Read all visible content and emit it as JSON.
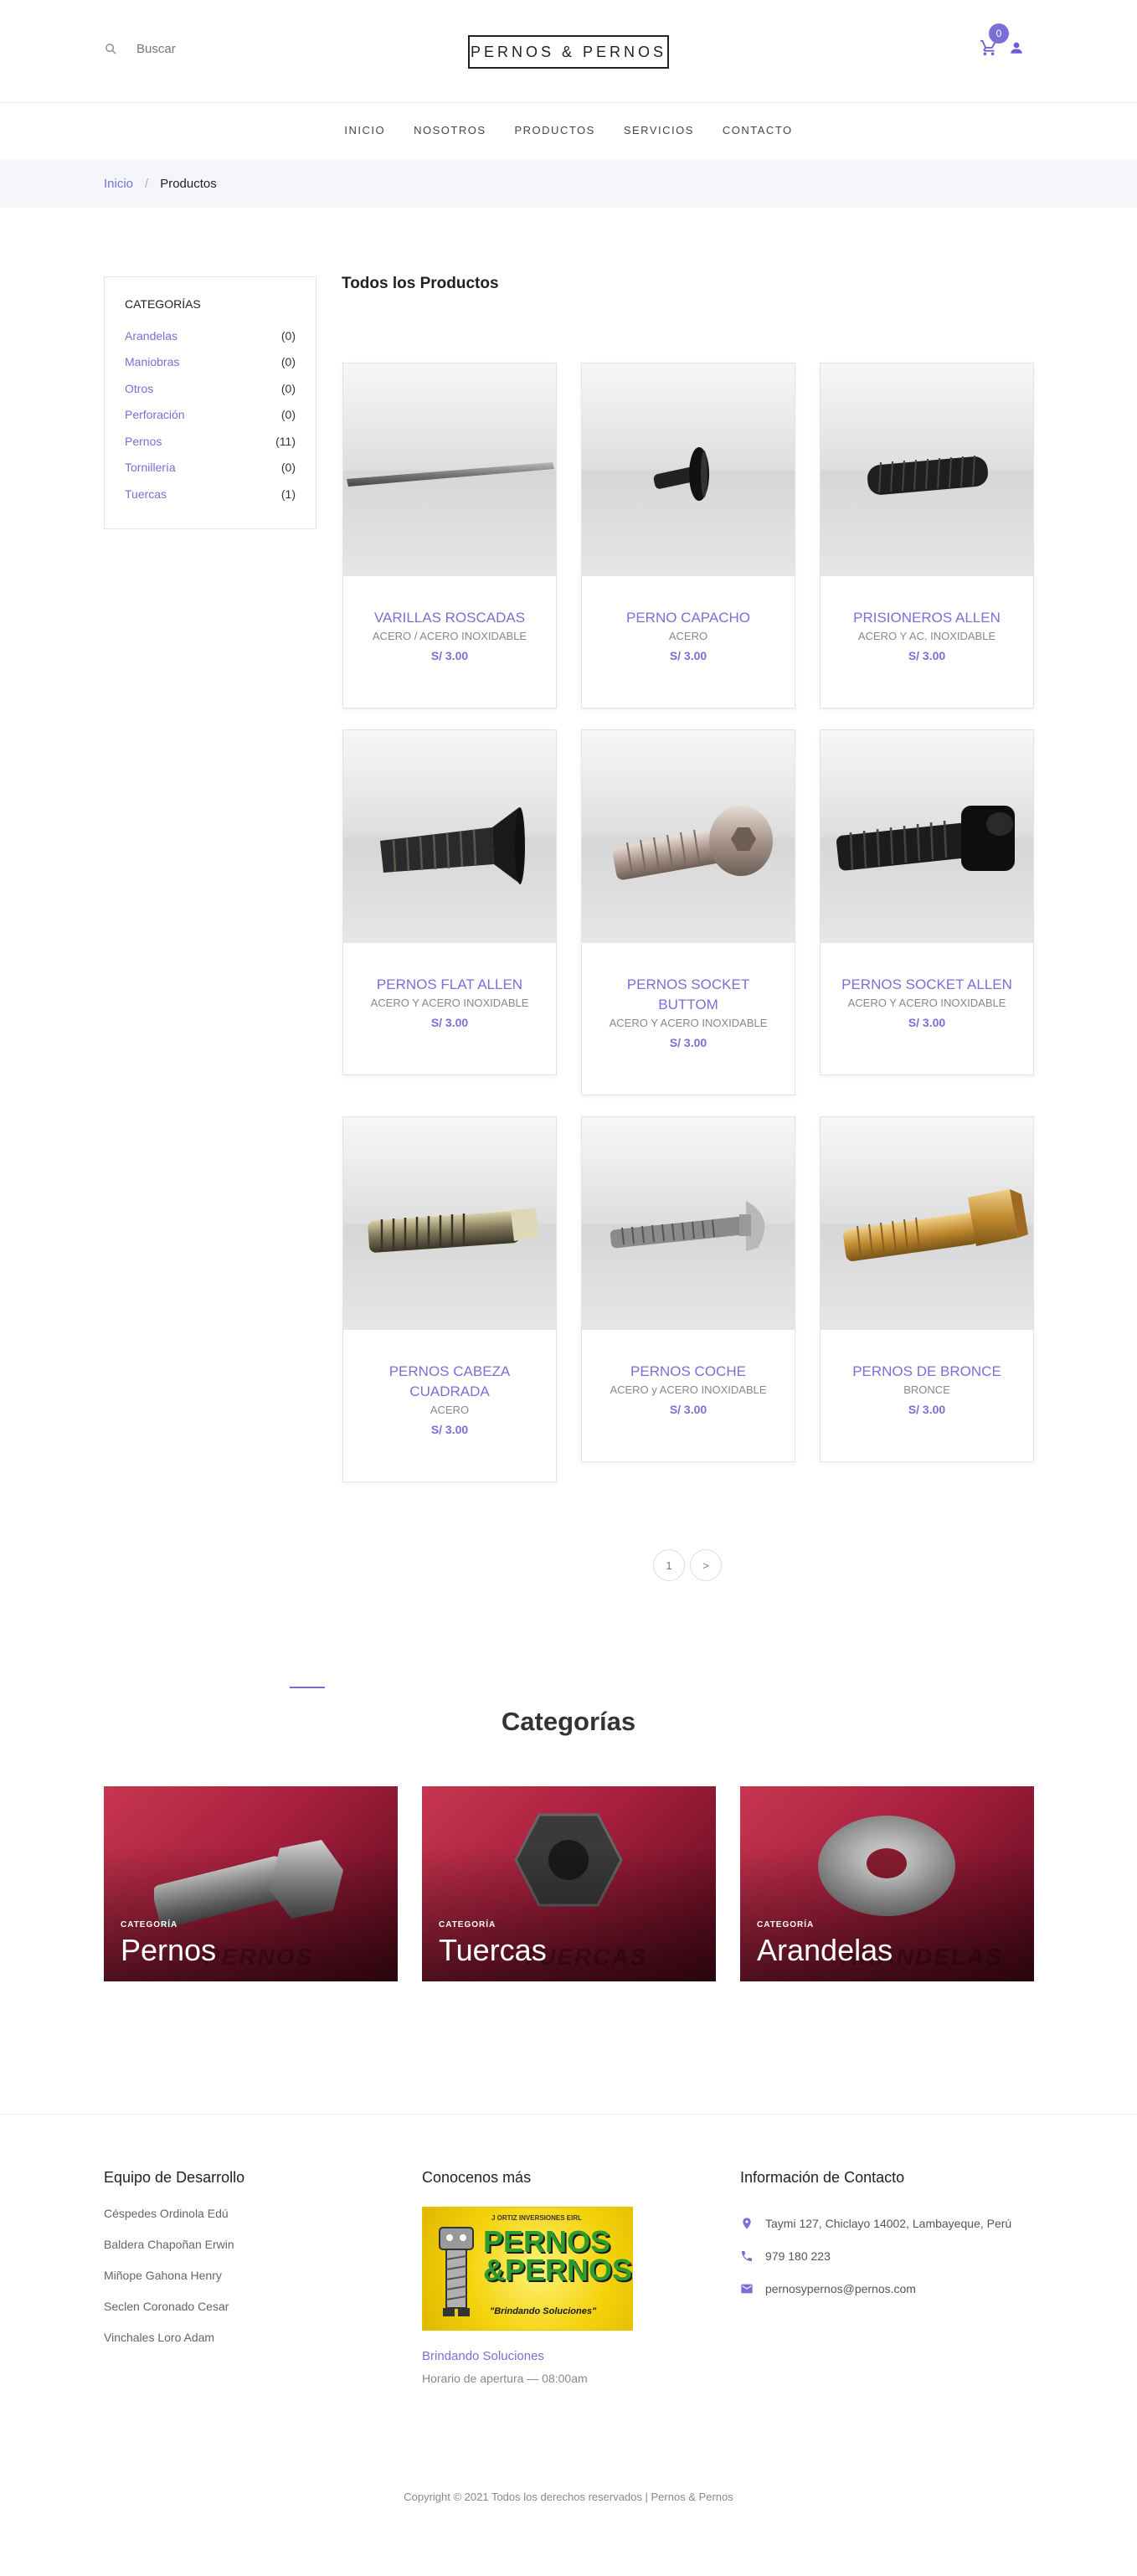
{
  "header": {
    "search_label": "Buscar",
    "logo": "PERNOS & PERNOS",
    "cart_count": "0"
  },
  "nav": [
    "INICIO",
    "NOSOTROS",
    "PRODUCTOS",
    "SERVICIOS",
    "CONTACTO"
  ],
  "breadcrumb": {
    "home": "Inicio",
    "separator": "/",
    "current": "Productos"
  },
  "sidebar": {
    "title": "CATEGORÍAS",
    "items": [
      {
        "name": "Arandelas",
        "count": "(0)"
      },
      {
        "name": "Maniobras",
        "count": "(0)"
      },
      {
        "name": "Otros",
        "count": "(0)"
      },
      {
        "name": "Perforación",
        "count": "(0)"
      },
      {
        "name": "Pernos",
        "count": "(11)"
      },
      {
        "name": "Tornillería",
        "count": "(0)"
      },
      {
        "name": "Tuercas",
        "count": "(1)"
      }
    ]
  },
  "products_title": "Todos los Productos",
  "products": [
    {
      "title": "VARILLAS ROSCADAS",
      "sub": "ACERO / ACERO INOXIDABLE",
      "price": "S/ 3.00",
      "icon": "threaded-rod"
    },
    {
      "title": "PERNO CAPACHO",
      "sub": "ACERO",
      "price": "S/ 3.00",
      "icon": "mushroom-bolt"
    },
    {
      "title": "PRISIONEROS ALLEN",
      "sub": "ACERO Y AC. INOXIDABLE",
      "price": "S/ 3.00",
      "icon": "set-screw"
    },
    {
      "title": "PERNOS FLAT ALLEN",
      "sub": "ACERO Y ACERO INOXIDABLE",
      "price": "S/ 3.00",
      "icon": "flat-head-bolt"
    },
    {
      "title": "PERNOS SOCKET BUTTOM",
      "sub": "ACERO Y ACERO INOXIDABLE",
      "price": "S/ 3.00",
      "icon": "button-head-bolt"
    },
    {
      "title": "PERNOS SOCKET ALLEN",
      "sub": "ACERO Y ACERO INOXIDABLE",
      "price": "S/ 3.00",
      "icon": "socket-cap-bolt"
    },
    {
      "title": "PERNOS CABEZA CUADRADA",
      "sub": "ACERO",
      "price": "S/ 3.00",
      "icon": "square-head-bolt"
    },
    {
      "title": "PERNOS COCHE",
      "sub": "ACERO y ACERO INOXIDABLE",
      "price": "S/ 3.00",
      "icon": "carriage-bolt"
    },
    {
      "title": "PERNOS DE BRONCE",
      "sub": "BRONCE",
      "price": "S/ 3.00",
      "icon": "brass-hex-bolt"
    }
  ],
  "pager": {
    "page": "1",
    "next": ">"
  },
  "categories": {
    "heading": "Categorías",
    "tiles": [
      {
        "tag": "CATEGORÍA",
        "name": "Pernos",
        "ghost": "PERNOS"
      },
      {
        "tag": "CATEGORÍA",
        "name": "Tuercas",
        "ghost": "TUERCAS"
      },
      {
        "tag": "CATEGORÍA",
        "name": "Arandelas",
        "ghost": "ARANDELAS"
      }
    ]
  },
  "footer": {
    "team_title": "Equipo de Desarrollo",
    "team": [
      "Céspedes Ordinola Edú",
      "Baldera Chapoñan Erwin",
      "Miñope Gahona Henry",
      "Seclen Coronado Cesar",
      "Vinchales Loro Adam"
    ],
    "more_title": "Conocenos más",
    "logo_top": "J ORTIZ INVERSIONES EIRL",
    "logo_main_1": "PERNOS",
    "logo_main_2": "&PERNOS",
    "logo_slogan": "\"Brindando Soluciones\"",
    "tagline": "Brindando Soluciones",
    "hours": "Horario de apertura — 08:00am",
    "contact_title": "Información de Contacto",
    "address": "Taymi 127, Chiclayo 14002, Lambayeque, Perú",
    "phone": "979 180 223",
    "email": "pernosypernos@pernos.com"
  },
  "copyright": "Copyright © 2021 Todos los derechos reservados | Pernos & Pernos",
  "colors": {
    "accent": "#7a6fd6",
    "tile_red": "#b3213f"
  }
}
